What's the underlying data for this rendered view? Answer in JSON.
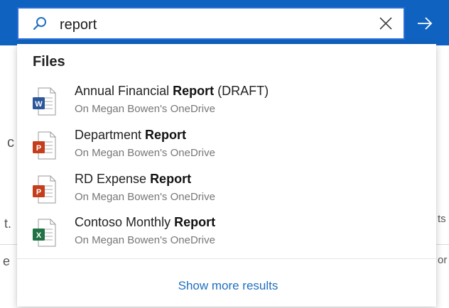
{
  "search": {
    "query": "report",
    "placeholder": ""
  },
  "background": {
    "left_chars": [
      "c",
      "t.",
      "e"
    ],
    "right_chars": [
      "ts",
      "or"
    ]
  },
  "dropdown": {
    "section_title": "Files",
    "results": [
      {
        "name_prefix": "Annual Financial ",
        "name_match": "Report",
        "name_suffix": " (DRAFT)",
        "location": "On Megan Bowen's OneDrive",
        "file_type": "word",
        "icon": "word-file-icon",
        "badge": "W",
        "color": "#2b579a"
      },
      {
        "name_prefix": "Department ",
        "name_match": "Report",
        "name_suffix": "",
        "location": "On Megan Bowen's OneDrive",
        "file_type": "powerpoint",
        "icon": "powerpoint-file-icon",
        "badge": "P",
        "color": "#c43e1c"
      },
      {
        "name_prefix": "RD Expense ",
        "name_match": "Report",
        "name_suffix": "",
        "location": "On Megan Bowen's OneDrive",
        "file_type": "powerpoint",
        "icon": "powerpoint-file-icon",
        "badge": "P",
        "color": "#c43e1c"
      },
      {
        "name_prefix": "Contoso Monthly ",
        "name_match": "Report",
        "name_suffix": "",
        "location": "On Megan Bowen's OneDrive",
        "file_type": "excel",
        "icon": "excel-file-icon",
        "badge": "X",
        "color": "#217346"
      }
    ],
    "show_more_label": "Show more results"
  },
  "colors": {
    "accent": "#0f62c0",
    "link": "#1f6fc0"
  }
}
